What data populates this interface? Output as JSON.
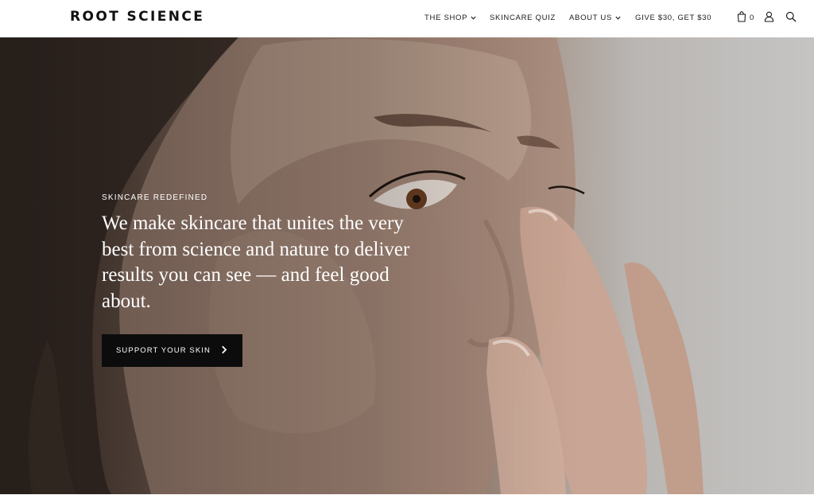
{
  "header": {
    "logo": "ROOT SCIENCE",
    "nav": {
      "shop": "THE SHOP",
      "quiz": "SKINCARE QUIZ",
      "about": "ABOUT US",
      "give": "GIVE $30, GET $30"
    },
    "cart_count": "0",
    "icons": [
      "cart-icon",
      "account-icon",
      "search-icon",
      "chevron-down-icon"
    ]
  },
  "hero": {
    "eyebrow": "SKINCARE REDEFINED",
    "headline": "We make skincare that unites the very best from science and nature to deliver results you can see — and feel good about.",
    "cta_label": "SUPPORT YOUR SKIN"
  },
  "colors": {
    "text_dark": "#1a1a1a",
    "cta_bg": "#0c0c0c",
    "hero_text": "#ffffff",
    "header_bg": "#ffffff"
  }
}
